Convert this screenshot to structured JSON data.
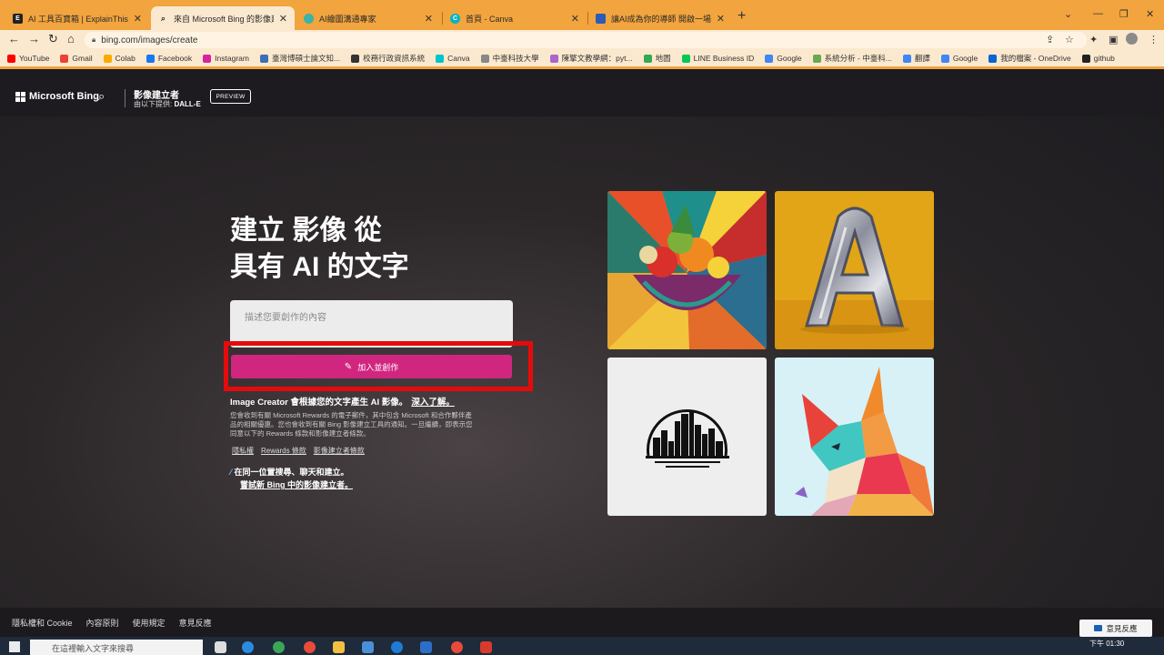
{
  "browser": {
    "tabs": [
      {
        "title": "AI 工具百寶箱 | ExplainThis",
        "icon": "explainthis-icon",
        "active": false
      },
      {
        "title": "來自 Microsoft Bing 的影像建立",
        "icon": "bing-search-icon",
        "active": true
      },
      {
        "title": "AI繪圖溝通專家",
        "icon": "ai-icon",
        "active": false
      },
      {
        "title": "首頁 - Canva",
        "icon": "canva-icon",
        "active": false
      },
      {
        "title": "讓AI成為你的導師 開啟一場智慧",
        "icon": "chat-icon",
        "active": false
      }
    ],
    "url": "bing.com/images/create",
    "bookmarks": [
      {
        "label": "YouTube",
        "color": "#ff0000"
      },
      {
        "label": "Gmail",
        "color": "#ea4335"
      },
      {
        "label": "Colab",
        "color": "#f9ab00"
      },
      {
        "label": "Facebook",
        "color": "#1877f2"
      },
      {
        "label": "Instagram",
        "color": "#d6249f"
      },
      {
        "label": "臺灣博碩士論文知...",
        "color": "#3b6fb6"
      },
      {
        "label": "校務行政資訊系統",
        "color": "#333333"
      },
      {
        "label": "Canva",
        "color": "#00c4cc"
      },
      {
        "label": "中臺科技大學",
        "color": "#888888"
      },
      {
        "label": "陳擎文教學網：pyt...",
        "color": "#aa66cc"
      },
      {
        "label": "地圖",
        "color": "#34a853"
      },
      {
        "label": "LINE Business ID",
        "color": "#06c755"
      },
      {
        "label": "Google",
        "color": "#4285f4"
      },
      {
        "label": "系統分析 - 中臺科...",
        "color": "#6aa84f"
      },
      {
        "label": "翻譯",
        "color": "#4285f4"
      },
      {
        "label": "Google",
        "color": "#4285f4"
      },
      {
        "label": "我的檔案 - OneDrive",
        "color": "#0a64d2"
      },
      {
        "label": "github",
        "color": "#222222"
      }
    ]
  },
  "header": {
    "brand": "Microsoft Bing",
    "product_title": "影像建立者",
    "provided_by": "由以下提供:",
    "provider": "DALL-E",
    "badge": "PREVIEW"
  },
  "hero": {
    "line1": "建立 影像 從",
    "line2": "具有 AI 的文字"
  },
  "prompt": {
    "placeholder": "描述您要創作的內容",
    "value": ""
  },
  "create_button": {
    "label": "加入並創作"
  },
  "info": {
    "text": "Image Creator 會根據您的文字產生 AI 影像。",
    "link": "深入了解。"
  },
  "description": "您會收到有關 Microsoft Rewards 的電子郵件，其中包含 Microsoft 和合作夥伴產品的相關優惠。您也會收到有關 Bing 影像建立工具的通知。一旦繼續，即表示您同意以下的 Rewards 條款和影像建立者條款。",
  "legal_links": [
    "隱私權",
    "Rewards 條款",
    "影像建立者條款"
  ],
  "promo": {
    "line1": "在同一位置搜尋、聊天和建立。",
    "line2": "嘗試新 Bing 中的影像建立者。"
  },
  "gallery": [
    {
      "name": "fruit-bowl-image"
    },
    {
      "name": "chrome-letter-a-image"
    },
    {
      "name": "city-skyline-logo-image"
    },
    {
      "name": "paper-fox-image"
    }
  ],
  "footer": {
    "links": [
      "隱私權和 Cookie",
      "內容原則",
      "使用規定",
      "意見反應"
    ],
    "feedback": "意見反應"
  },
  "taskbar": {
    "search_placeholder": "在這裡輸入文字來搜尋",
    "clock": "下午 01:30"
  }
}
